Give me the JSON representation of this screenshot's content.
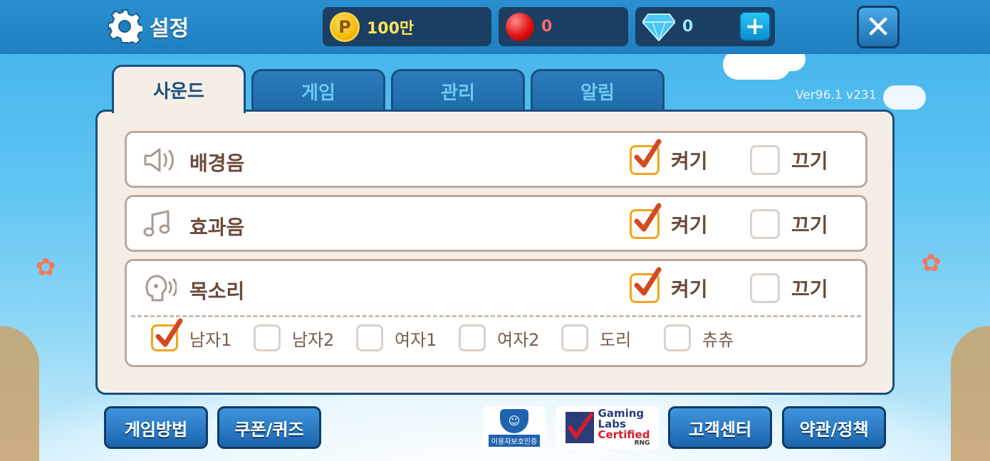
{
  "header": {
    "title": "설정",
    "currency": {
      "points": "100만",
      "points_coin_letter": "P",
      "red": "0",
      "gems": "0"
    },
    "version": "Ver96.1 v231"
  },
  "tabs": [
    {
      "label": "사운드",
      "active": true
    },
    {
      "label": "게임",
      "active": false
    },
    {
      "label": "관리",
      "active": false
    },
    {
      "label": "알림",
      "active": false
    }
  ],
  "sound": {
    "rows": [
      {
        "label": "배경음",
        "icon": "speaker-icon",
        "on": true
      },
      {
        "label": "효과음",
        "icon": "music-note-icon",
        "on": true
      },
      {
        "label": "목소리",
        "icon": "voice-head-icon",
        "on": true
      }
    ],
    "on_label": "켜기",
    "off_label": "끄기",
    "voices": [
      {
        "label": "남자1",
        "checked": true
      },
      {
        "label": "남자2",
        "checked": false
      },
      {
        "label": "여자1",
        "checked": false
      },
      {
        "label": "여자2",
        "checked": false
      },
      {
        "label": "도리",
        "checked": false
      },
      {
        "label": "츄츄",
        "checked": false
      }
    ]
  },
  "footer": {
    "howto": "게임방법",
    "coupon": "쿠폰/퀴즈",
    "protect_badge": "이용자보호인증",
    "gli": {
      "line1": "Gaming",
      "line2": "Labs",
      "line3": "Certified",
      "line4": "RNG"
    },
    "support": "고객센터",
    "terms": "약관/정책"
  },
  "colors": {
    "topbar": "#1f7fc0",
    "panel": "#f5eee6",
    "checkbox_accent": "#f2a51d",
    "check_mark": "#d24a1e",
    "text_brown": "#6b4a3a"
  }
}
